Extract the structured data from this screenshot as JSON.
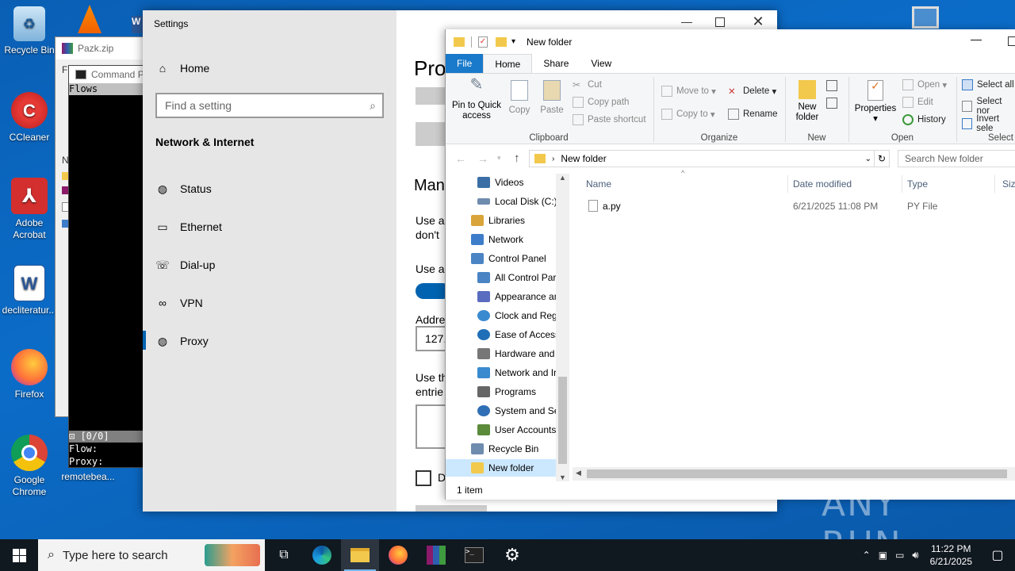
{
  "desktop": {
    "icons": [
      {
        "label": "Recycle Bin"
      },
      {
        "label": "CCleaner"
      },
      {
        "label": "Adobe Acrobat"
      },
      {
        "label": "decliteratur..."
      },
      {
        "label": "Firefox"
      },
      {
        "label": "Google Chrome"
      },
      {
        "label": "remotebea..."
      }
    ]
  },
  "bg_windows": {
    "zip_title": "Pazk.zip",
    "cmd_title": "Command P",
    "cmd_line1": "Flows",
    "cmd_status": "⊡ [0/0]",
    "cmd_flow": "Flow:",
    "cmd_proxy": "Proxy:",
    "zip_side_f": "Fi",
    "zip_side_n": "N"
  },
  "settings": {
    "title": "Settings",
    "home": "Home",
    "search_placeholder": "Find a setting",
    "section": "Network & Internet",
    "nav": [
      {
        "label": "Status",
        "icon": "globe-icon"
      },
      {
        "label": "Ethernet",
        "icon": "monitor-icon"
      },
      {
        "label": "Dial-up",
        "icon": "dialup-icon"
      },
      {
        "label": "VPN",
        "icon": "vpn-icon"
      },
      {
        "label": "Proxy",
        "icon": "globe-icon"
      }
    ],
    "right": {
      "heading": "Pro",
      "manual": "Man",
      "use_a_1": "Use a",
      "dont": "don't",
      "use_a_2": "Use a",
      "address": "Addre",
      "address_value": "127.",
      "use_the": "Use th",
      "entries": "entrie",
      "checkbox_letter": "D"
    }
  },
  "explorer": {
    "title": "New folder",
    "tabs": {
      "file": "File",
      "home": "Home",
      "share": "Share",
      "view": "View"
    },
    "ribbon": {
      "pin": "Pin to Quick access",
      "copy": "Copy",
      "paste": "Paste",
      "cut": "Cut",
      "copy_path": "Copy path",
      "paste_shortcut": "Paste shortcut",
      "clipboard": "Clipboard",
      "move_to": "Move to",
      "copy_to": "Copy to",
      "delete": "Delete",
      "rename": "Rename",
      "organize": "Organize",
      "new_folder": "New folder",
      "new": "New",
      "properties": "Properties",
      "open": "Open",
      "edit": "Edit",
      "history": "History",
      "open_group": "Open",
      "select_all": "Select all",
      "select_none": "Select nor",
      "invert_selection": "Invert sele",
      "select_group": "Select"
    },
    "address": "New folder",
    "search_placeholder": "Search New folder",
    "columns": {
      "name": "Name",
      "date": "Date modified",
      "type": "Type",
      "size": "Size"
    },
    "files": [
      {
        "name": "a.py",
        "date": "6/21/2025 11:08 PM",
        "type": "PY File"
      }
    ],
    "tree": [
      {
        "label": "Videos",
        "color": "#3a6ea5"
      },
      {
        "label": "Local Disk (C:)",
        "color": "#6e8cae"
      },
      {
        "label": "Libraries",
        "color": "#d9a53a"
      },
      {
        "label": "Network",
        "color": "#3d7cc9"
      },
      {
        "label": "Control Panel",
        "color": "#4a84c4"
      },
      {
        "label": "All Control Par",
        "color": "#4a84c4"
      },
      {
        "label": "Appearance an",
        "color": "#5a6cc0"
      },
      {
        "label": "Clock and Regi",
        "color": "#3a8ad0"
      },
      {
        "label": "Ease of Access",
        "color": "#1f6fb8"
      },
      {
        "label": "Hardware and",
        "color": "#777777"
      },
      {
        "label": "Network and Ir",
        "color": "#3a8ad0"
      },
      {
        "label": "Programs",
        "color": "#666666"
      },
      {
        "label": "System and Se",
        "color": "#2f6fb5"
      },
      {
        "label": "User Accounts",
        "color": "#5a8a3a"
      },
      {
        "label": "Recycle Bin",
        "color": "#6e8cae"
      },
      {
        "label": "New folder",
        "color": "#f2c94c"
      }
    ],
    "status": "1 item"
  },
  "taskbar": {
    "search_placeholder": "Type here to search",
    "time": "11:22 PM",
    "date": "6/21/2025"
  },
  "watermark": "ANY RUN"
}
